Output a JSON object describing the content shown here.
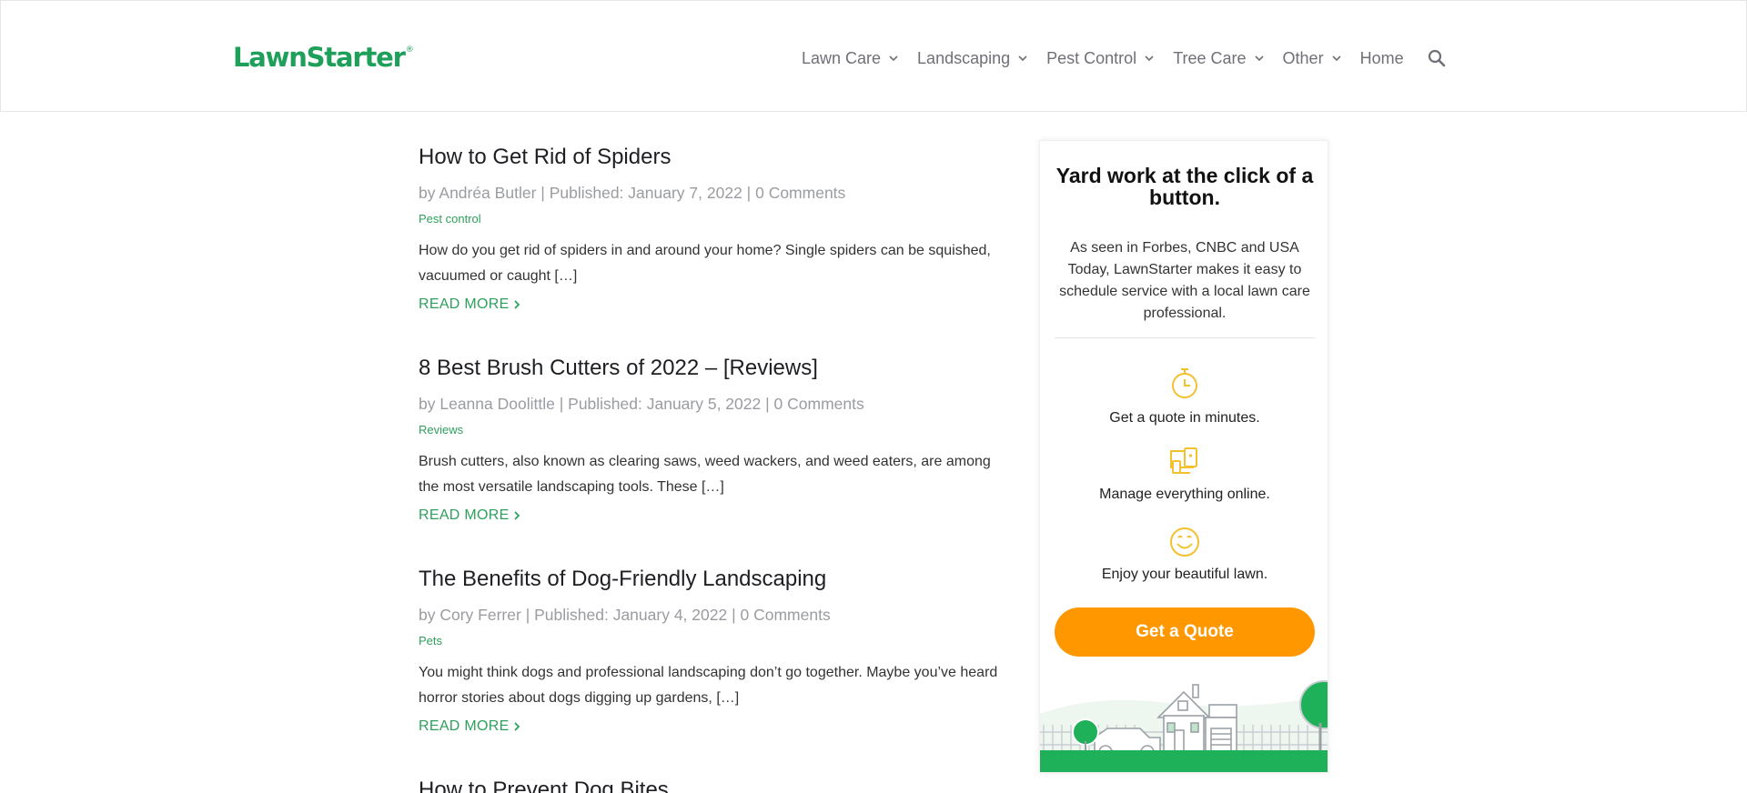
{
  "header": {
    "logo": "LawnStarter",
    "logo_mark": "®",
    "nav": [
      {
        "label": "Lawn Care",
        "dropdown": true
      },
      {
        "label": "Landscaping",
        "dropdown": true
      },
      {
        "label": "Pest Control",
        "dropdown": true
      },
      {
        "label": "Tree Care",
        "dropdown": true
      },
      {
        "label": "Other",
        "dropdown": true
      }
    ],
    "home_label": "Home",
    "search_icon": "search-icon"
  },
  "posts": [
    {
      "title": "How to Get Rid of Spiders",
      "by": "by",
      "author": "Andréa Butler",
      "published": "Published: January 7, 2022",
      "comments": "0 Comments",
      "category": "Pest control",
      "excerpt": "How do you get rid of spiders in and around your home? Single spiders can be squished, vacuumed or caught […]",
      "read_more": "READ MORE"
    },
    {
      "title": "8 Best Brush Cutters of 2022 – [Reviews]",
      "by": "by",
      "author": "Leanna Doolittle",
      "published": "Published: January 5, 2022",
      "comments": "0 Comments",
      "category": "Reviews",
      "excerpt": "Brush cutters, also known as clearing saws, weed wackers, and weed eaters, are among the most versatile landscaping tools.  These […]",
      "read_more": "READ MORE"
    },
    {
      "title": "The Benefits of Dog-Friendly Landscaping",
      "by": "by",
      "author": "Cory Ferrer",
      "published": "Published: January 4, 2022",
      "comments": "0 Comments",
      "category": "Pets",
      "excerpt": "You might think dogs and professional landscaping don’t go together. Maybe you’ve heard horror stories about dogs digging up gardens, […]",
      "read_more": "READ MORE"
    }
  ],
  "next_post_title": "How to Prevent Dog Bites",
  "separator": "|",
  "sidebar": {
    "title": "Yard work at the click of a button.",
    "description": "As seen in Forbes, CNBC and USA Today, LawnStarter makes it easy to schedule service with a local lawn care professional.",
    "features": [
      {
        "icon": "stopwatch-icon",
        "label": "Get a quote in minutes."
      },
      {
        "icon": "devices-icon",
        "label": "Manage everything online."
      },
      {
        "icon": "smiley-icon",
        "label": "Enjoy your beautiful lawn."
      }
    ],
    "cta": "Get a Quote"
  },
  "colors": {
    "brand_green": "#1fa05a",
    "accent_orange": "#ff9800",
    "icon_yellow": "#f2c12e",
    "muted_text": "#9a9ca1"
  }
}
